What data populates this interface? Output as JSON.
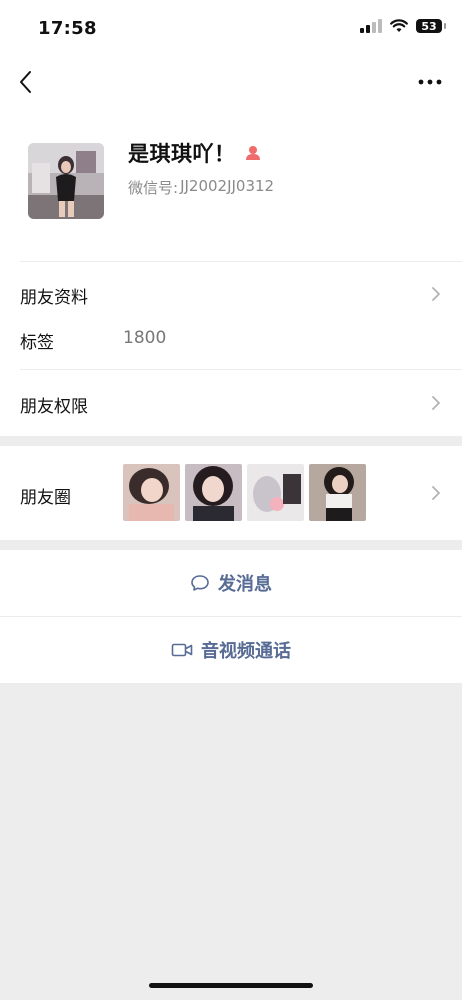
{
  "status_bar": {
    "time": "17:58",
    "battery": "53"
  },
  "profile": {
    "name": "是琪琪吖！",
    "wechat_id_label": "微信号:",
    "wechat_id": "JJ2002JJ0312"
  },
  "rows": {
    "friend_info": "朋友资料",
    "tags_label": "标签",
    "tags_value": "1800",
    "permissions": "朋友权限",
    "moments": "朋友圈"
  },
  "actions": {
    "message": "发消息",
    "video_call": "音视频通话"
  },
  "icons": {
    "back": "back-arrow-icon",
    "more": "more-dots-icon",
    "gender": "female-gender-icon",
    "chat": "chat-bubble-icon",
    "video": "video-camera-icon",
    "chevron": "chevron-right-icon"
  },
  "colors": {
    "link": "#576b95",
    "female": "#f06b6b",
    "background": "#ededed"
  }
}
